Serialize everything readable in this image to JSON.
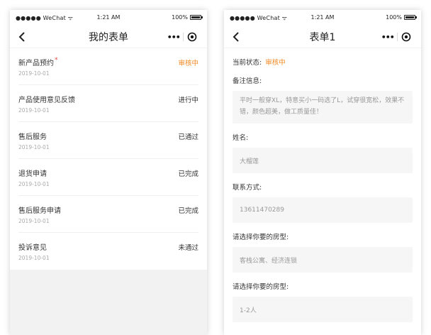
{
  "status_bar": {
    "carrier": "●●●●● WeChat ᯤ",
    "time": "1:21 AM",
    "battery_pct": "100%"
  },
  "left": {
    "title": "我的表单",
    "items": [
      {
        "title": "新产品预约",
        "required_mark": "*",
        "date": "2019-10-01",
        "status": "审核中",
        "status_type": "pending"
      },
      {
        "title": "产品使用意见反馈",
        "required_mark": "",
        "date": "2019-10-01",
        "status": "进行中",
        "status_type": "normal"
      },
      {
        "title": "售后服务",
        "required_mark": "",
        "date": "2019-10-01",
        "status": "已通过",
        "status_type": "normal"
      },
      {
        "title": "退货申请",
        "required_mark": "",
        "date": "2019-10-01",
        "status": "已完成",
        "status_type": "normal"
      },
      {
        "title": "售后服务申请",
        "required_mark": "",
        "date": "2019-10-01",
        "status": "已完成",
        "status_type": "normal"
      },
      {
        "title": "投诉意见",
        "required_mark": "",
        "date": "2019-10-01",
        "status": "未通过",
        "status_type": "normal"
      }
    ]
  },
  "right": {
    "title": "表单1",
    "status_label": "当前状态:",
    "status_value": "审核中",
    "fields": [
      {
        "label": "备注信息:",
        "value": "平时一般穿XL，特意买小一码选了L，试穿很宽松，效果不错，颜色超美，做工质量佳！",
        "multiline": true
      },
      {
        "label": "姓名:",
        "value": "大榴莲",
        "multiline": false
      },
      {
        "label": "联系方式:",
        "value": "13611470289",
        "multiline": false
      },
      {
        "label": "请选择你要的房型:",
        "value": "客栈公寓、经济连锁",
        "multiline": false
      },
      {
        "label": "请选择你要的房型:",
        "value": "1-2人",
        "multiline": false
      }
    ]
  },
  "colors": {
    "accent_pending": "#f08a24",
    "required": "#e64340",
    "field_bg": "#f6f6f6"
  },
  "icons": {
    "back": "chevron-left-icon",
    "more": "more-dots-icon",
    "close": "target-close-icon"
  }
}
